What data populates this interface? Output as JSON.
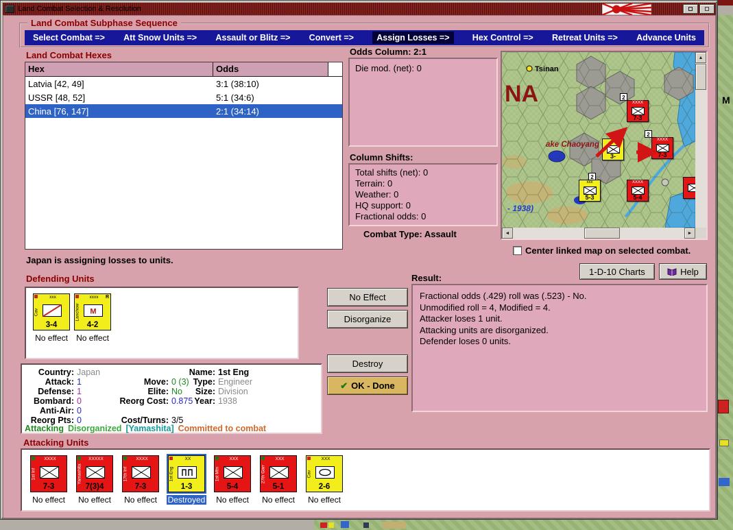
{
  "titlebar": {
    "title": "Land Combat Selection & Resolution"
  },
  "subphase": {
    "title": "Land Combat Subphase Sequence",
    "items": [
      {
        "label": "Select Combat =>"
      },
      {
        "label": "Att Snow Units =>"
      },
      {
        "label": "Assault or Blitz =>"
      },
      {
        "label": "Convert =>"
      },
      {
        "label": "Assign Losses =>",
        "active": true
      },
      {
        "label": "Hex Control =>"
      },
      {
        "label": "Retreat Units =>"
      },
      {
        "label": "Advance Units"
      }
    ]
  },
  "combat_hexes": {
    "title": "Land Combat Hexes",
    "columns": {
      "hex": "Hex",
      "odds": "Odds"
    },
    "rows": [
      {
        "hex": "Latvia [42, 49]",
        "odds": "3:1 (38:10)"
      },
      {
        "hex": "USSR [48, 52]",
        "odds": "5:1 (34:6)"
      },
      {
        "hex": "China [76, 147]",
        "odds": "2:1 (34:14)",
        "selected": true
      }
    ]
  },
  "odds_column": {
    "title": "Odds Column: 2:1",
    "die_mod": "Die mod. (net): 0"
  },
  "column_shifts": {
    "title": "Column Shifts:",
    "lines": [
      "Total shifts (net): 0",
      "Terrain: 0",
      "Weather: 0",
      "HQ support: 0",
      "Fractional odds: 0"
    ]
  },
  "combat_type": "Combat Type: Assault",
  "map": {
    "city": "Tsinan",
    "region_label": "NA",
    "lake_label": "ake Chaoyang",
    "year_label": "- 1938)",
    "units": [
      {
        "strength": "7-3",
        "size": "XXXX",
        "color": "red"
      },
      {
        "strength": "7-3",
        "size": "XXXX",
        "color": "red"
      },
      {
        "strength": "3-",
        "size": "",
        "color": "yellow"
      },
      {
        "strength": "5-3",
        "size": "xxx",
        "color": "yellow"
      },
      {
        "strength": "5-4",
        "size": "XXXX",
        "color": "red"
      }
    ],
    "badges": [
      "2",
      "2",
      "2"
    ],
    "checkbox_label": "Center linked map on selected combat.",
    "checkbox_checked": false
  },
  "status_line": "Japan is assigning losses to units.",
  "top_buttons": {
    "charts": "1-D-10 Charts",
    "help": "Help"
  },
  "defending": {
    "title": "Defending Units",
    "units": [
      {
        "name": "Cav",
        "size": "xxx",
        "strength": "3-4",
        "status": "No effect",
        "color": "yellow",
        "symbol": "cavalry"
      },
      {
        "name": "Lanchow",
        "size": "xxxx",
        "strength": "4-2",
        "status": "No effect",
        "color": "yellow",
        "symbol": "militia",
        "marker": "R"
      }
    ]
  },
  "action_buttons": {
    "no_effect": "No Effect",
    "disorganize": "Disorganize",
    "destroy": "Destroy",
    "ok_done": "OK - Done"
  },
  "result": {
    "title": "Result:",
    "lines": [
      "Fractional odds (.429) roll was (.523)  - No.",
      "Unmodified roll = 4, Modified = 4.",
      "Attacker loses 1 unit.",
      "Attacking units are disorganized.",
      "Defender loses 0 units."
    ]
  },
  "unit_detail": {
    "labels": {
      "country": "Country:",
      "attack": "Attack:",
      "defense": "Defense:",
      "bombard": "Bombard:",
      "antiair": "Anti-Air:",
      "reorgpts": "Reorg Pts:",
      "move": "Move:",
      "elite": "Elite:",
      "reorgcost": "Reorg Cost:",
      "costturns": "Cost/Turns:",
      "name": "Name:",
      "type": "Type:",
      "size": "Size:",
      "year": "Year:"
    },
    "values": {
      "country": "Japan",
      "attack": "1",
      "defense": "1",
      "bombard": "0",
      "antiair": "0",
      "reorgpts": "0",
      "move": "0 (3)",
      "elite": "No",
      "reorgcost": "0.875",
      "costturns": "3/5",
      "name": "1st Eng",
      "type": "Engineer",
      "size": "Division",
      "year": "1938"
    },
    "flags": {
      "f1": "Attacking",
      "f2": "Disorganized",
      "f3": "[Yamashita]",
      "f4": "Committed to combat"
    },
    "flag_colors": {
      "f1": "#1e8a1e",
      "f2": "#3aa83a",
      "f3": "#149a9a",
      "f4": "#cf6a2d"
    }
  },
  "attacking": {
    "title": "Attacking Units",
    "units": [
      {
        "name": "1st Inf",
        "size": "XXXX",
        "strength": "7-3",
        "status": "No effect",
        "color": "red",
        "symbol": "infantry"
      },
      {
        "name": "Yamashita",
        "size": "XXXXX",
        "strength": "7(3)4",
        "status": "No effect",
        "color": "red",
        "symbol": "infantry"
      },
      {
        "name": "17th Inf",
        "size": "XXXX",
        "strength": "7-3",
        "status": "No effect",
        "color": "red",
        "symbol": "infantry"
      },
      {
        "name": "1st Eng",
        "size": "XX",
        "strength": "1-3",
        "status": "Destroyed",
        "color": "yellow",
        "symbol": "engineer",
        "selected": true
      },
      {
        "name": "1st Mtn",
        "size": "XXX",
        "strength": "5-4",
        "status": "No effect",
        "color": "red",
        "symbol": "infantry"
      },
      {
        "name": "27th Garr",
        "size": "XXX",
        "strength": "5-1",
        "status": "No effect",
        "color": "red",
        "symbol": "infantry"
      },
      {
        "name": "Cav",
        "size": "XXX",
        "strength": "2-6",
        "status": "No effect",
        "color": "yellow",
        "symbol": "motorized"
      }
    ]
  },
  "background": {
    "m_label": "M"
  }
}
